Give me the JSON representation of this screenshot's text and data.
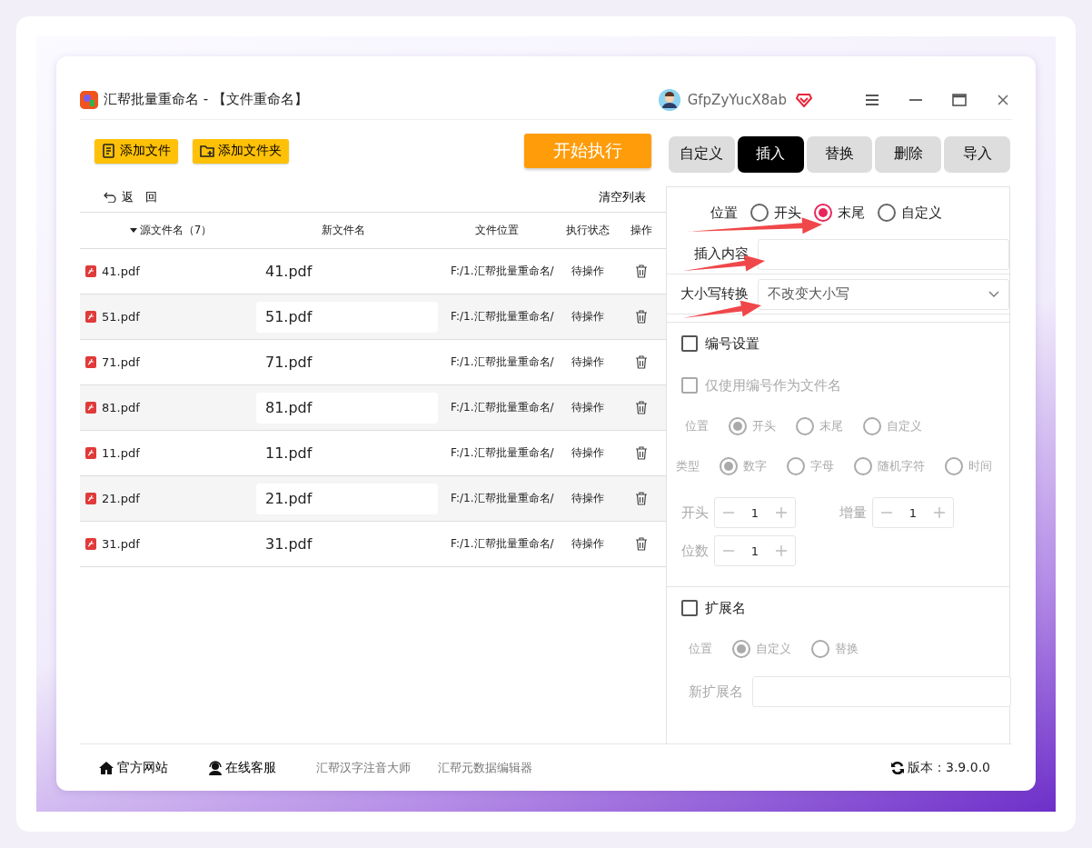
{
  "window": {
    "title": "汇帮批量重命名 - 【文件重命名】",
    "user": "GfpZyYucX8ab"
  },
  "toolbar": {
    "buttons": [
      {
        "kind": "file",
        "label": "添加文件"
      },
      {
        "kind": "folder",
        "label": "添加文件夹"
      }
    ],
    "start": "开始执行"
  },
  "tabs": [
    {
      "label": "自定义",
      "selected": false
    },
    {
      "label": "插入",
      "selected": true
    },
    {
      "label": "替换",
      "selected": false
    },
    {
      "label": "删除",
      "selected": false
    },
    {
      "label": "导入",
      "selected": false
    }
  ],
  "list": {
    "back": "返　回",
    "clear": "清空列表",
    "columns": [
      "源文件名（7）",
      "新文件名",
      "文件位置",
      "执行状态",
      "操作"
    ],
    "rows": [
      {
        "name": "41.pdf",
        "new_name": "41.pdf",
        "location": "F:/1.汇帮批量重命名/",
        "status": "待操作"
      },
      {
        "name": "51.pdf",
        "new_name": "51.pdf",
        "location": "F:/1.汇帮批量重命名/",
        "status": "待操作"
      },
      {
        "name": "71.pdf",
        "new_name": "71.pdf",
        "location": "F:/1.汇帮批量重命名/",
        "status": "待操作"
      },
      {
        "name": "81.pdf",
        "new_name": "81.pdf",
        "location": "F:/1.汇帮批量重命名/",
        "status": "待操作"
      },
      {
        "name": "11.pdf",
        "new_name": "11.pdf",
        "location": "F:/1.汇帮批量重命名/",
        "status": "待操作"
      },
      {
        "name": "21.pdf",
        "new_name": "21.pdf",
        "location": "F:/1.汇帮批量重命名/",
        "status": "待操作"
      },
      {
        "name": "31.pdf",
        "new_name": "31.pdf",
        "location": "F:/1.汇帮批量重命名/",
        "status": "待操作"
      }
    ]
  },
  "insert": {
    "position": {
      "label": "位置",
      "options": [
        {
          "label": "开头",
          "selected": false
        },
        {
          "label": "末尾",
          "selected": true
        },
        {
          "label": "自定义",
          "selected": false
        }
      ]
    },
    "content": {
      "label": "插入内容"
    },
    "case": {
      "label": "大小写转换",
      "value": "不改变大小写"
    }
  },
  "numbering": {
    "checkbox": {
      "label": "编号设置",
      "checked": false
    },
    "only_number": {
      "label": "仅使用编号作为文件名",
      "checked": false,
      "disabled": true
    },
    "position": {
      "label": "位置",
      "disabled": true,
      "options": [
        {
          "label": "开头",
          "selected": true
        },
        {
          "label": "末尾",
          "selected": false
        },
        {
          "label": "自定义",
          "selected": false
        }
      ]
    },
    "type": {
      "label": "类型",
      "disabled": true,
      "options": [
        {
          "label": "数字",
          "selected": true
        },
        {
          "label": "字母",
          "selected": false
        },
        {
          "label": "随机字符",
          "selected": false
        },
        {
          "label": "时间",
          "selected": false
        }
      ]
    },
    "steppers": [
      {
        "label": "开头",
        "value": "1"
      },
      {
        "label": "增量",
        "value": "1"
      },
      {
        "label": "位数",
        "value": "1"
      }
    ]
  },
  "extension": {
    "checkbox": {
      "label": "扩展名",
      "checked": false
    },
    "position": {
      "label": "位置",
      "disabled": true,
      "options": [
        {
          "label": "自定义",
          "selected": true
        },
        {
          "label": "替换",
          "selected": false
        }
      ]
    },
    "new_ext": {
      "label": "新扩展名"
    }
  },
  "footer": {
    "links": [
      {
        "kind": "home",
        "label": "官方网站"
      },
      {
        "kind": "support",
        "label": "在线客服"
      }
    ],
    "apps": [
      "汇帮汉字注音大师",
      "汇帮元数据编辑器"
    ],
    "version": "版本：3.9.0.0"
  }
}
